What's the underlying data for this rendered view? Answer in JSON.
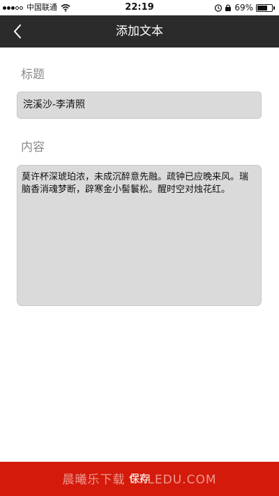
{
  "status_bar": {
    "carrier": "中国联通",
    "time": "22:19",
    "battery_percent": "69%",
    "battery_level": 0.69,
    "icons": [
      "signal-dots-icon",
      "wifi-icon",
      "alarm-icon",
      "rotation-lock-icon",
      "battery-icon"
    ]
  },
  "nav": {
    "back_icon": "chevron-left-icon",
    "title": "添加文本"
  },
  "form": {
    "title_label": "标题",
    "title_value": "浣溪沙-李清照",
    "content_label": "内容",
    "content_value": "莫许杯深琥珀浓，未成沉醉意先融。疏钟已应晚来风。瑞脑香消魂梦断，辟寒金小髻鬟松。醒时空对烛花红。"
  },
  "save_bar": {
    "label": "保存",
    "watermark": "晨曦乐下载 CXLEDU.COM",
    "color": "#d41b0b"
  }
}
